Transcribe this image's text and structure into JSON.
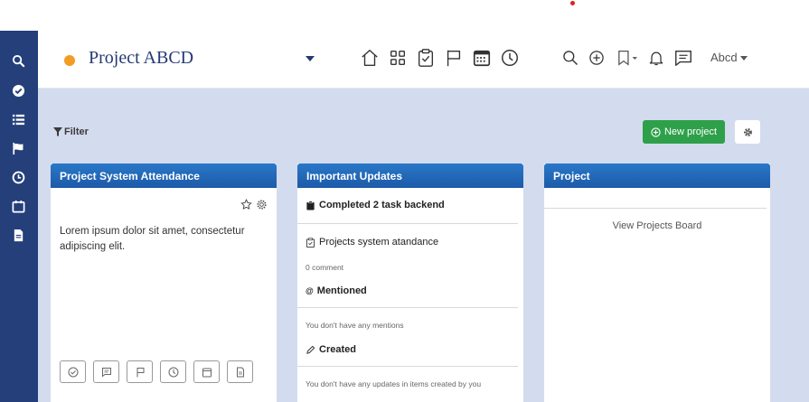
{
  "project": {
    "name": "Project ABCD",
    "dot_color": "#f39c23"
  },
  "user": {
    "name": "Abcd"
  },
  "sidebar": {
    "icons": [
      "search-icon",
      "check-circle-icon",
      "list-icon",
      "flag-icon",
      "clock-icon",
      "calendar-icon",
      "document-icon"
    ]
  },
  "header": {
    "nav_icons": [
      "home-icon",
      "grid-icon",
      "clipboard-check-icon",
      "flag-icon",
      "calendar-icon",
      "clock-icon"
    ],
    "tool_icons": [
      "search-icon",
      "add-circle-icon",
      "bookmark-icon",
      "bell-icon",
      "message-icon"
    ]
  },
  "toolbar": {
    "filter_label": "Filter",
    "new_project_label": "New project"
  },
  "colors": {
    "sidebar": "#243f7a",
    "card_header": "#1c5aa8",
    "new_project": "#2ea04a",
    "content_bg": "#d3dbef"
  },
  "cards": {
    "attendance": {
      "title": "Project System Attendance",
      "body": "Lorem ipsum dolor sit amet, consectetur adipiscing elit."
    },
    "updates": {
      "title": "Important Updates",
      "completed": "Completed 2 task backend",
      "task_name": "Projects system atandance",
      "comment_count": "0 comment",
      "mentioned_label": "Mentioned",
      "mentioned_empty": "You don't have any mentions",
      "created_label": "Created",
      "created_empty": "You don't have any updates in items created by you"
    },
    "project": {
      "title": "Project",
      "view_board": "View Projects Board"
    }
  }
}
